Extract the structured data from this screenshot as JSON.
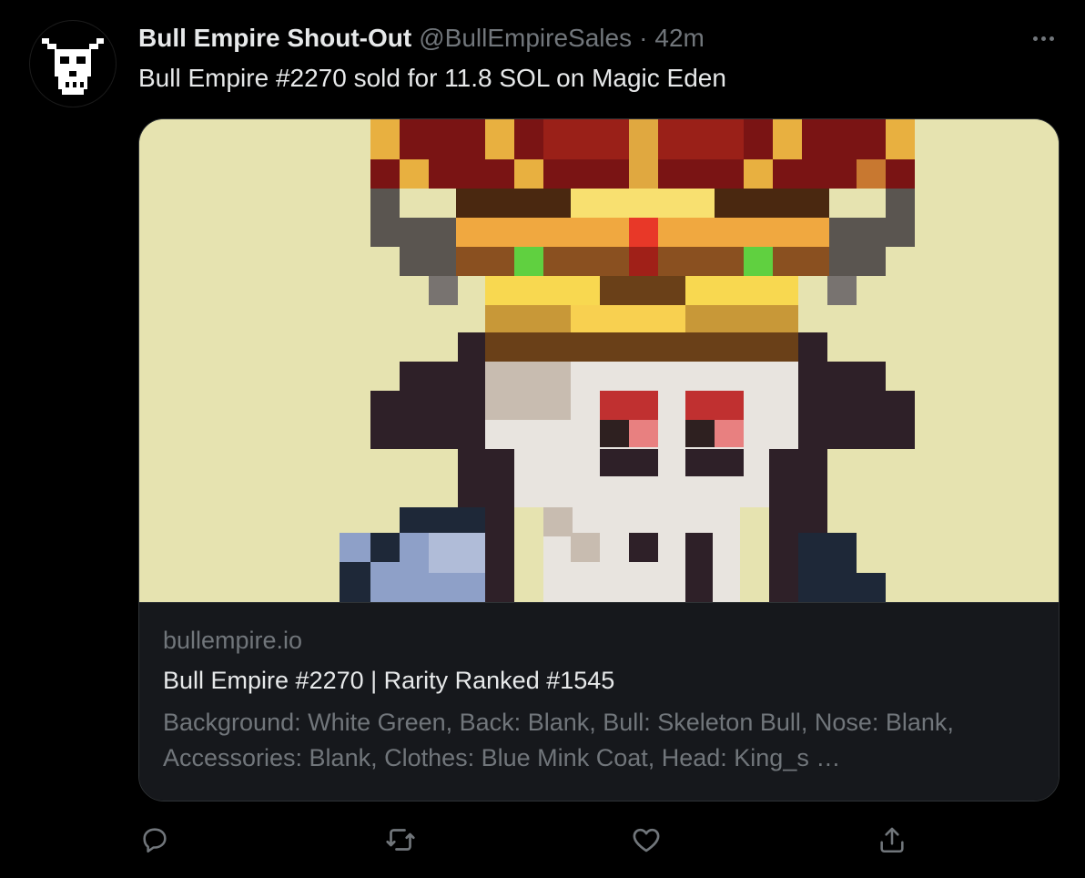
{
  "tweet": {
    "author_name": "Bull Empire Shout-Out",
    "author_handle": "@BullEmpireSales",
    "separator": "·",
    "time": "42m",
    "text": "Bull Empire #2270 sold for 11.8 SOL on Magic Eden"
  },
  "card": {
    "domain": "bullempire.io",
    "title": "Bull Empire #2270 | Rarity Ranked #1545",
    "description": "Background: White Green, Back: Blank, Bull: Skeleton Bull, Nose: Blank, Accessories: Blank, Clothes: Blue Mink Coat, Head: King_s …"
  },
  "icons": {
    "avatar": "bull-skull-logo",
    "more": "more-horizontal-icon",
    "reply": "reply-icon",
    "retweet": "retweet-icon",
    "like": "heart-icon",
    "share": "share-icon"
  },
  "colors": {
    "background": "#000000",
    "text_primary": "#e7e9ea",
    "text_secondary": "#71767b",
    "card_body": "#16181c",
    "card_border": "#2f3336",
    "image_background": "#e6e3b0"
  }
}
